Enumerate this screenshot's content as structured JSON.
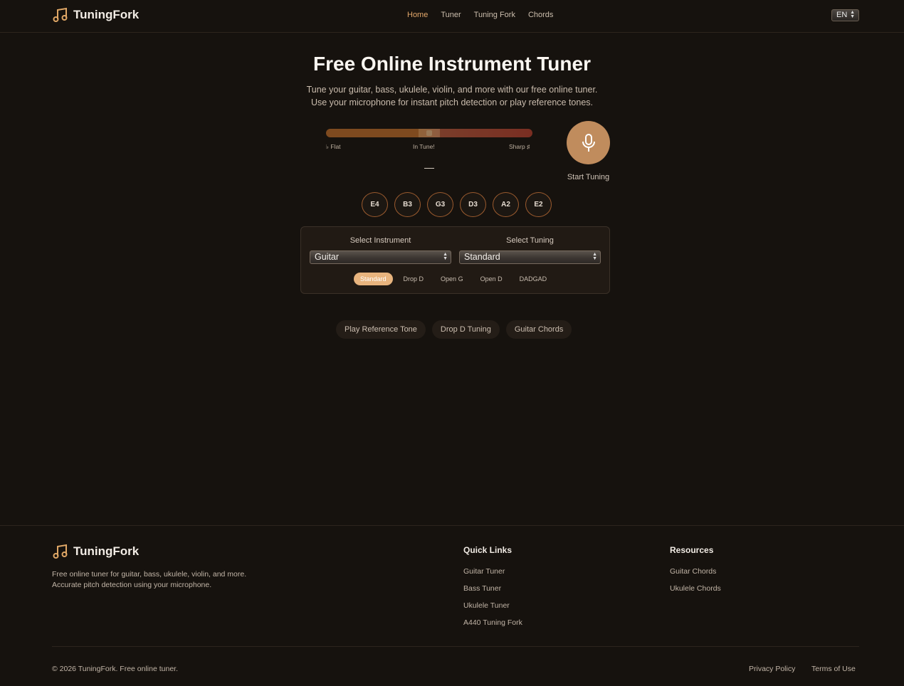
{
  "app": {
    "brand": "TuningFork"
  },
  "nav": [
    {
      "label": "Home",
      "active": true
    },
    {
      "label": "Tuner"
    },
    {
      "label": "Tuning Fork"
    },
    {
      "label": "Chords"
    }
  ],
  "language": {
    "selected": "EN"
  },
  "hero": {
    "title": "Free Online Instrument Tuner",
    "subtitle_line1": "Tune your guitar, bass, ukulele, violin, and more with our free online tuner.",
    "subtitle_line2": "Use your microphone for instant pitch detection or play reference tones."
  },
  "meter": {
    "flat_label": "♭ Flat",
    "in_tune_label": "In Tune!",
    "sharp_label": "Sharp ♯",
    "note_display": "—"
  },
  "tuner": {
    "start_label": "Start Tuning"
  },
  "strings": [
    "E4",
    "B3",
    "G3",
    "D3",
    "A2",
    "E2"
  ],
  "settings": {
    "instrument_label": "Select Instrument",
    "instrument_value": "Guitar",
    "tuning_label": "Select Tuning",
    "tuning_value": "Standard",
    "presets": [
      "Standard",
      "Drop D",
      "Open G",
      "Open D",
      "DADGAD"
    ],
    "active_preset": "Standard"
  },
  "actions": [
    "Play Reference Tone",
    "Drop D Tuning",
    "Guitar Chords"
  ],
  "footer": {
    "brand": "TuningFork",
    "desc_line1": "Free online tuner for guitar, bass, ukulele, violin, and more.",
    "desc_line2": "Accurate pitch detection using your microphone.",
    "quick_links_title": "Quick Links",
    "quick_links": [
      "Guitar Tuner",
      "Bass Tuner",
      "Ukulele Tuner",
      "A440 Tuning Fork"
    ],
    "resources_title": "Resources",
    "resources": [
      "Guitar Chords",
      "Ukulele Chords"
    ],
    "copyright": "© 2026 TuningFork. Free online tuner.",
    "privacy": "Privacy Policy",
    "terms": "Terms of Use"
  },
  "colors": {
    "accent": "#e3a86b",
    "background": "#16120e",
    "mic": "#c08c5d"
  },
  "icons": {
    "logo": "music-note-icon",
    "mic": "microphone-icon"
  }
}
